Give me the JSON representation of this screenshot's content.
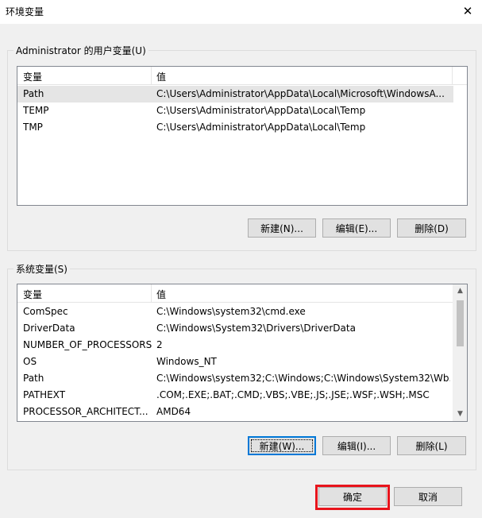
{
  "window": {
    "title": "环境变量",
    "close_symbol": "✕"
  },
  "user_vars": {
    "group_label": "Administrator 的用户变量(U)",
    "col_variable": "变量",
    "col_value": "值",
    "rows": [
      {
        "name": "Path",
        "value": "C:\\Users\\Administrator\\AppData\\Local\\Microsoft\\WindowsA...",
        "selected": true
      },
      {
        "name": "TEMP",
        "value": "C:\\Users\\Administrator\\AppData\\Local\\Temp"
      },
      {
        "name": "TMP",
        "value": "C:\\Users\\Administrator\\AppData\\Local\\Temp"
      }
    ],
    "buttons": {
      "new": "新建(N)...",
      "edit": "编辑(E)...",
      "delete": "删除(D)"
    }
  },
  "system_vars": {
    "group_label": "系统变量(S)",
    "col_variable": "变量",
    "col_value": "值",
    "rows": [
      {
        "name": "ComSpec",
        "value": "C:\\Windows\\system32\\cmd.exe"
      },
      {
        "name": "DriverData",
        "value": "C:\\Windows\\System32\\Drivers\\DriverData"
      },
      {
        "name": "NUMBER_OF_PROCESSORS",
        "value": "2"
      },
      {
        "name": "OS",
        "value": "Windows_NT"
      },
      {
        "name": "Path",
        "value": "C:\\Windows\\system32;C:\\Windows;C:\\Windows\\System32\\Wb..."
      },
      {
        "name": "PATHEXT",
        "value": ".COM;.EXE;.BAT;.CMD;.VBS;.VBE;.JS;.JSE;.WSF;.WSH;.MSC"
      },
      {
        "name": "PROCESSOR_ARCHITECT...",
        "value": "AMD64"
      }
    ],
    "buttons": {
      "new": "新建(W)...",
      "edit": "编辑(I)...",
      "delete": "删除(L)"
    }
  },
  "footer": {
    "ok": "确定",
    "cancel": "取消"
  },
  "colors": {
    "highlight": "#e8141c",
    "focus": "#0078d7"
  }
}
